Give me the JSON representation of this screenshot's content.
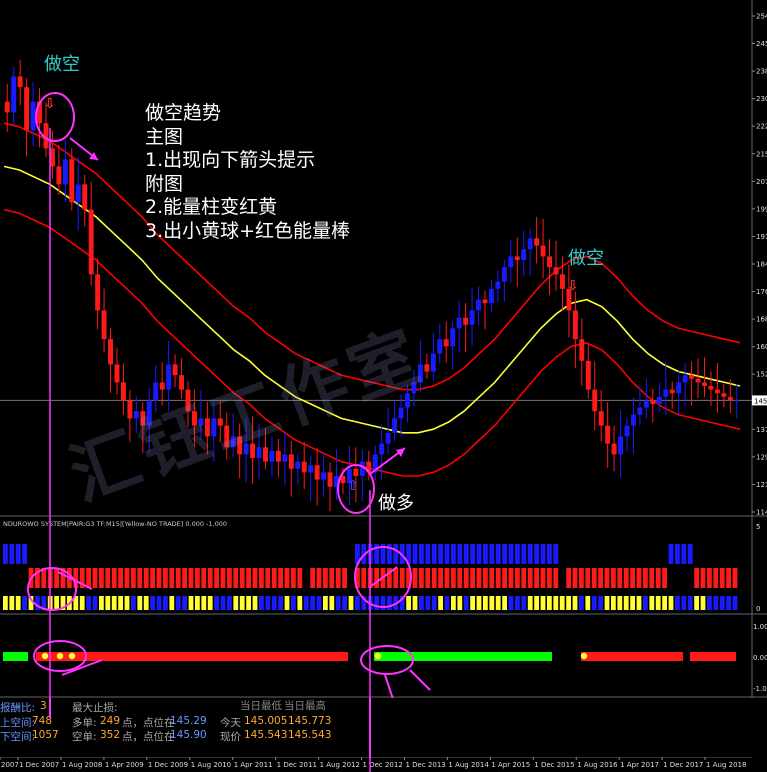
{
  "annotations": {
    "short_top": "做空",
    "short_right": "做空",
    "long_bottom": "做多",
    "notes": [
      "做空趋势",
      "主图",
      "1.出现向下箭头提示",
      "附图",
      "2.能量柱变红黄",
      "3.出小黄球+红色能量棒"
    ],
    "watermark": "汇钰工作室",
    "arrow_glyph": "⇩",
    "up_glyph": "⇧"
  },
  "indicator": {
    "title": "NDUROWO SYSTEM|PAIR:G3 TF:M15|[Yellow-NO TRADE] 0.000 -1.000",
    "axis_high": "5",
    "axis_low": "0",
    "axis2_high": "1.00",
    "axis2_mid": "0.00",
    "axis2_low": "-1.00"
  },
  "info_panel": {
    "row1_label": "报酬比:",
    "row1_value": "3",
    "row1_label2": "最大止损:",
    "row1_current_label": "当日最低",
    "row1_current_label2": "当日最高",
    "row2_label": "上空间:",
    "row2_value": "748",
    "row2_label2": "多单:",
    "row2_value2": "249",
    "row2_mid": "点，点位在",
    "row2_price": "145.29",
    "row2_today": "今天",
    "row2_low": "145.005",
    "row2_high": "145.773",
    "row3_label": "下空间:",
    "row3_value": "1057",
    "row3_label2": "空单:",
    "row3_value2": "352",
    "row3_mid": "点，点位在",
    "row3_price": "145.90",
    "row3_today": "现价",
    "row3_low": "145.543",
    "row3_high": "145.543"
  },
  "colors": {
    "bull": "#1a1aff",
    "bear": "#ff1a1a",
    "mid_line": "#ffff33",
    "band": "#ff0000",
    "annotation": "#ff33ff",
    "cyan_text": "#33cccc",
    "green": "#00ff00",
    "orange": "#ffaa33",
    "blue_text": "#6699ff"
  },
  "chart_data": {
    "type": "candlestick",
    "title": "",
    "y_ticks": [
      "254",
      "245",
      "238",
      "230",
      "222",
      "215",
      "207",
      "199",
      "191",
      "184",
      "176",
      "168",
      "160",
      "152",
      "145",
      "137",
      "129",
      "121",
      "114"
    ],
    "current_price_label": "145",
    "x_ticks": [
      "2007",
      "1 Dec 2007",
      "1 Aug 2008",
      "1 Apr 2009",
      "1 Dec 2009",
      "1 Aug 2010",
      "1 Apr 2011",
      "1 Dec 2011",
      "1 Aug 2012",
      "1 Dec 2012",
      "1 Dec 2013",
      "1 Aug 2014",
      "1 Apr 2015",
      "1 Dec 2015",
      "1 Aug 2016",
      "1 Apr 2017",
      "1 Dec 2017",
      "1 Aug 2018"
    ],
    "ylim": [
      114,
      254
    ],
    "close_series": [
      225,
      235,
      232,
      220,
      228,
      222,
      215,
      210,
      205,
      212,
      200,
      205,
      198,
      180,
      170,
      162,
      155,
      150,
      145,
      140,
      142,
      138,
      145,
      150,
      148,
      155,
      152,
      148,
      142,
      138,
      140,
      135,
      140,
      138,
      132,
      135,
      130,
      133,
      129,
      132,
      128,
      131,
      128,
      130,
      126,
      128,
      125,
      127,
      123,
      125,
      121,
      124,
      122,
      126,
      124,
      128,
      125,
      130,
      133,
      136,
      140,
      143,
      147,
      150,
      155,
      153,
      158,
      162,
      160,
      165,
      168,
      166,
      170,
      173,
      172,
      176,
      178,
      182,
      185,
      184,
      187,
      190,
      188,
      185,
      182,
      180,
      176,
      170,
      162,
      156,
      148,
      142,
      138,
      133,
      130,
      135,
      138,
      141,
      143,
      145,
      144,
      146,
      148,
      147,
      150,
      152,
      151,
      150,
      149,
      148,
      147,
      146,
      145,
      145
    ],
    "series": [
      {
        "name": "",
        "values": [
          210,
          209,
          207,
          205,
          202,
          199,
          196,
          192,
          188,
          184,
          179,
          175,
          171,
          167,
          163,
          159,
          156,
          152,
          149,
          146,
          144,
          142,
          140,
          139,
          138,
          137,
          136,
          136,
          137,
          139,
          142,
          146,
          150,
          155,
          160,
          165,
          169,
          172,
          173,
          171,
          167,
          162,
          158,
          155,
          153,
          152,
          151,
          150,
          149
        ]
      }
    ]
  }
}
